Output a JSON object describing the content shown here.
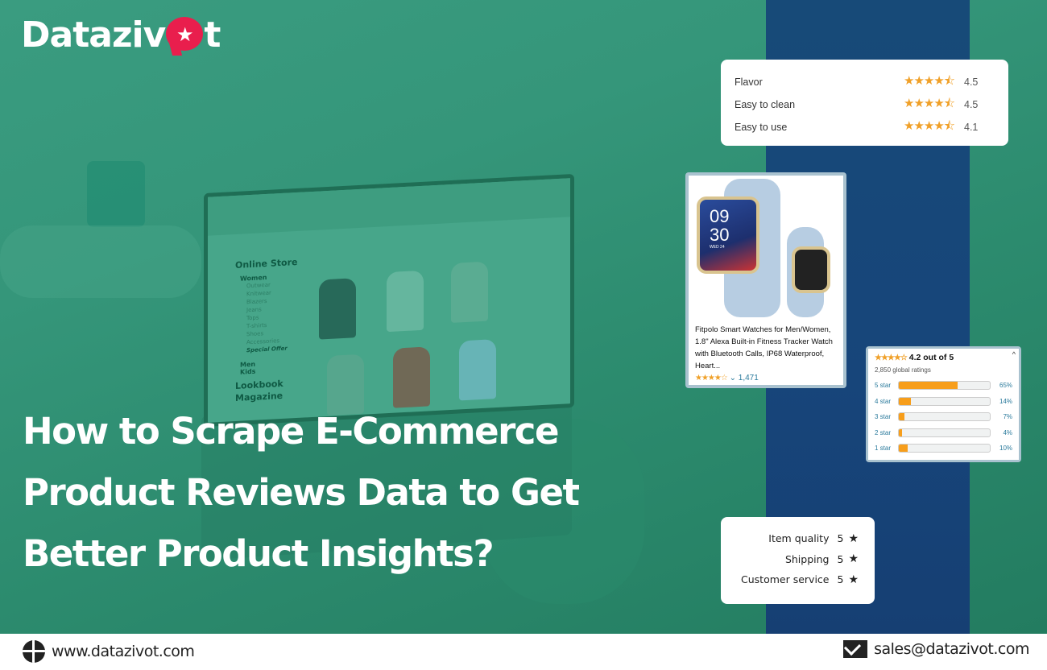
{
  "brand": {
    "name_prefix": "Dataziv",
    "name_suffix": "t",
    "logo_icon": "star-speech-bubble-icon",
    "accent": "#e91e4d"
  },
  "headline": {
    "lines": [
      "How to Scrape E-Commerce",
      "Product Reviews Data to Get",
      "Better Product Insights?"
    ]
  },
  "laptop_screen": {
    "store_title": "Online Store",
    "section": "Women",
    "items": [
      "Outwear",
      "Knitwear",
      "Blazers",
      "Jeans",
      "Tops",
      "T-shirts",
      "Shoes",
      "Accessories"
    ],
    "special": "Special Offer",
    "other_sections": [
      "Men",
      "Kids"
    ],
    "big_links": [
      "Lookbook",
      "Magazine"
    ]
  },
  "attribute_ratings": {
    "rows": [
      {
        "label": "Flavor",
        "stars": "★★★★⯪",
        "value": "4.5"
      },
      {
        "label": "Easy to clean",
        "stars": "★★★★⯪",
        "value": "4.5"
      },
      {
        "label": "Easy to use",
        "stars": "★★★★⯪",
        "value": "4.1"
      }
    ]
  },
  "product_card": {
    "watch_time_hour": "09",
    "watch_time_min": "30",
    "watch_date": "WED 24",
    "title": "Fitpolo Smart Watches for Men/Women, 1.8\" Alexa Built-in Fitness Tracker Watch with Bluetooth Calls, IP68 Waterproof, Heart...",
    "stars": "★★★★☆",
    "review_count": "⌄ 1,471"
  },
  "rating_histogram": {
    "stars": "★★★★☆",
    "summary": "4.2 out of 5",
    "global_ratings": "2,850 global ratings",
    "caret": "^",
    "bars": [
      {
        "label": "5 star",
        "percent": 65,
        "text": "65%"
      },
      {
        "label": "4 star",
        "percent": 14,
        "text": "14%"
      },
      {
        "label": "3 star",
        "percent": 7,
        "text": "7%"
      },
      {
        "label": "2 star",
        "percent": 4,
        "text": "4%"
      },
      {
        "label": "1 star",
        "percent": 10,
        "text": "10%"
      }
    ]
  },
  "seller_ratings": {
    "rows": [
      {
        "label": "Item quality",
        "value": "5",
        "star": "★"
      },
      {
        "label": "Shipping",
        "value": "5",
        "star": "★"
      },
      {
        "label": "Customer service",
        "value": "5",
        "star": "★"
      }
    ]
  },
  "footer": {
    "website": "www.datazivot.com",
    "email": "sales@datazivot.com"
  },
  "colors": {
    "overlay_green": "#2f9174",
    "band_blue": "#174a78",
    "star_orange": "#f0a028",
    "bar_orange": "#f79e1b"
  }
}
